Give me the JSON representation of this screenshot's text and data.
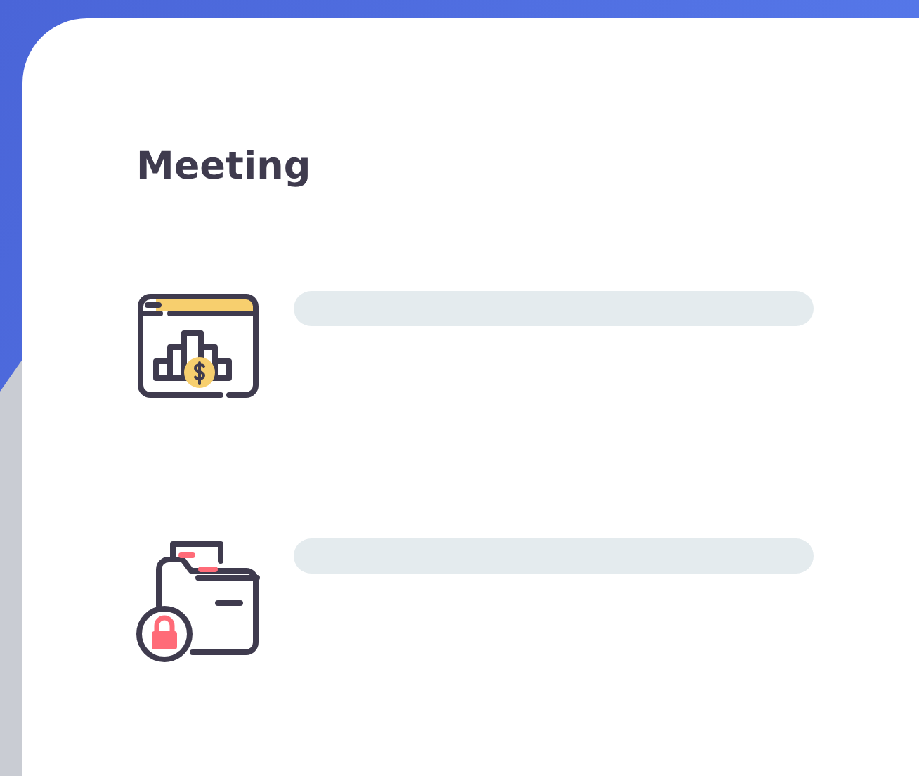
{
  "card": {
    "title": "Meeting",
    "items": [
      {
        "kind": "chart"
      },
      {
        "kind": "locked-folder"
      }
    ]
  }
}
